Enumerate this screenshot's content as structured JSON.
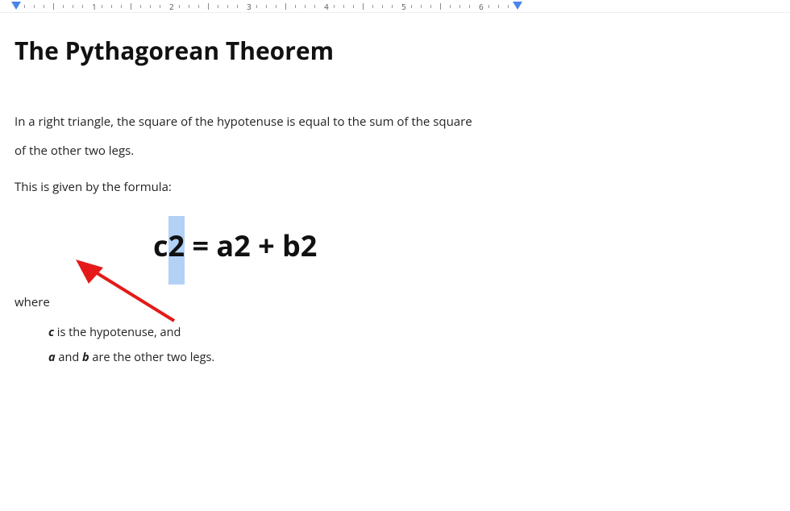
{
  "ruler": {
    "labels": [
      "1",
      "2",
      "3",
      "4",
      "5",
      "6"
    ]
  },
  "document": {
    "title": "The Pythagorean Theorem",
    "intro_line1": "In a right triangle, the square of the hypotenuse is equal to the sum of the square",
    "intro_line2": "of the other two legs.",
    "lead_in": "This is given by the formula:",
    "formula": {
      "part_c": "c",
      "highlighted": "2",
      "rest": " = a2 + b2"
    },
    "where_label": "where",
    "defs": {
      "c_var": "c",
      "c_text": " is the hypotenuse, and",
      "a_var": "a",
      "mid_text": " and ",
      "b_var": "b",
      "ab_text": " are the other two legs."
    }
  }
}
